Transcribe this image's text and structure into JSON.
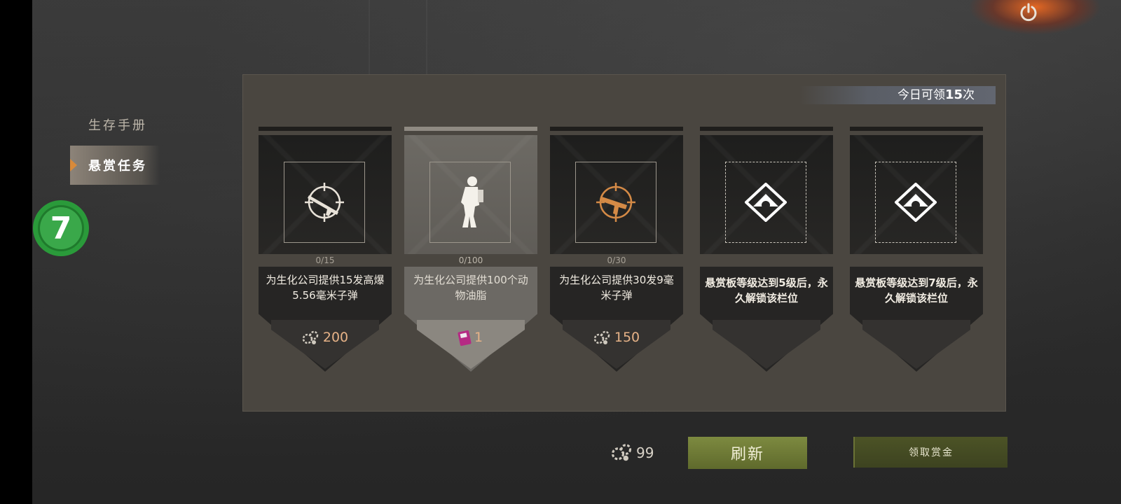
{
  "colors": {
    "accent_orange": "#e6b287",
    "button_green": "#7d8a40",
    "badge_green": "#2a9a3a"
  },
  "menu": {
    "items": [
      {
        "label": "生存手册",
        "active": false
      },
      {
        "label": "悬赏任务",
        "active": true
      }
    ],
    "level_badge": "7"
  },
  "panel": {
    "claims_prefix": "今日可领",
    "claims_count": "15",
    "claims_suffix": "次",
    "cards": [
      {
        "progress": "0/15",
        "description": "为生化公司提供15发高爆5.56毫米子弹",
        "reward": "200",
        "icon": "rifle-crosshair-icon",
        "reward_icon": "gear-currency-icon"
      },
      {
        "progress": "0/100",
        "description": "为生化公司提供100个动物油脂",
        "reward": "1",
        "icon": "soldier-figure-icon",
        "reward_icon": "ticket-icon"
      },
      {
        "progress": "0/30",
        "description": "为生化公司提供30发9毫米子弹",
        "reward": "150",
        "icon": "smg-crosshair-icon",
        "reward_icon": "gear-currency-icon"
      },
      {
        "progress": "",
        "description": "悬赏板等级达到5级后，永久解锁该栏位",
        "reward": "",
        "icon": "lock-icon",
        "reward_icon": ""
      },
      {
        "progress": "",
        "description": "悬赏板等级达到7级后，永久解锁该栏位",
        "reward": "",
        "icon": "lock-icon",
        "reward_icon": ""
      }
    ]
  },
  "footer": {
    "currency_amount": "99",
    "currency_icon": "gear-currency-icon",
    "refresh_label": "刷新",
    "claim_label": "领取赏金"
  }
}
